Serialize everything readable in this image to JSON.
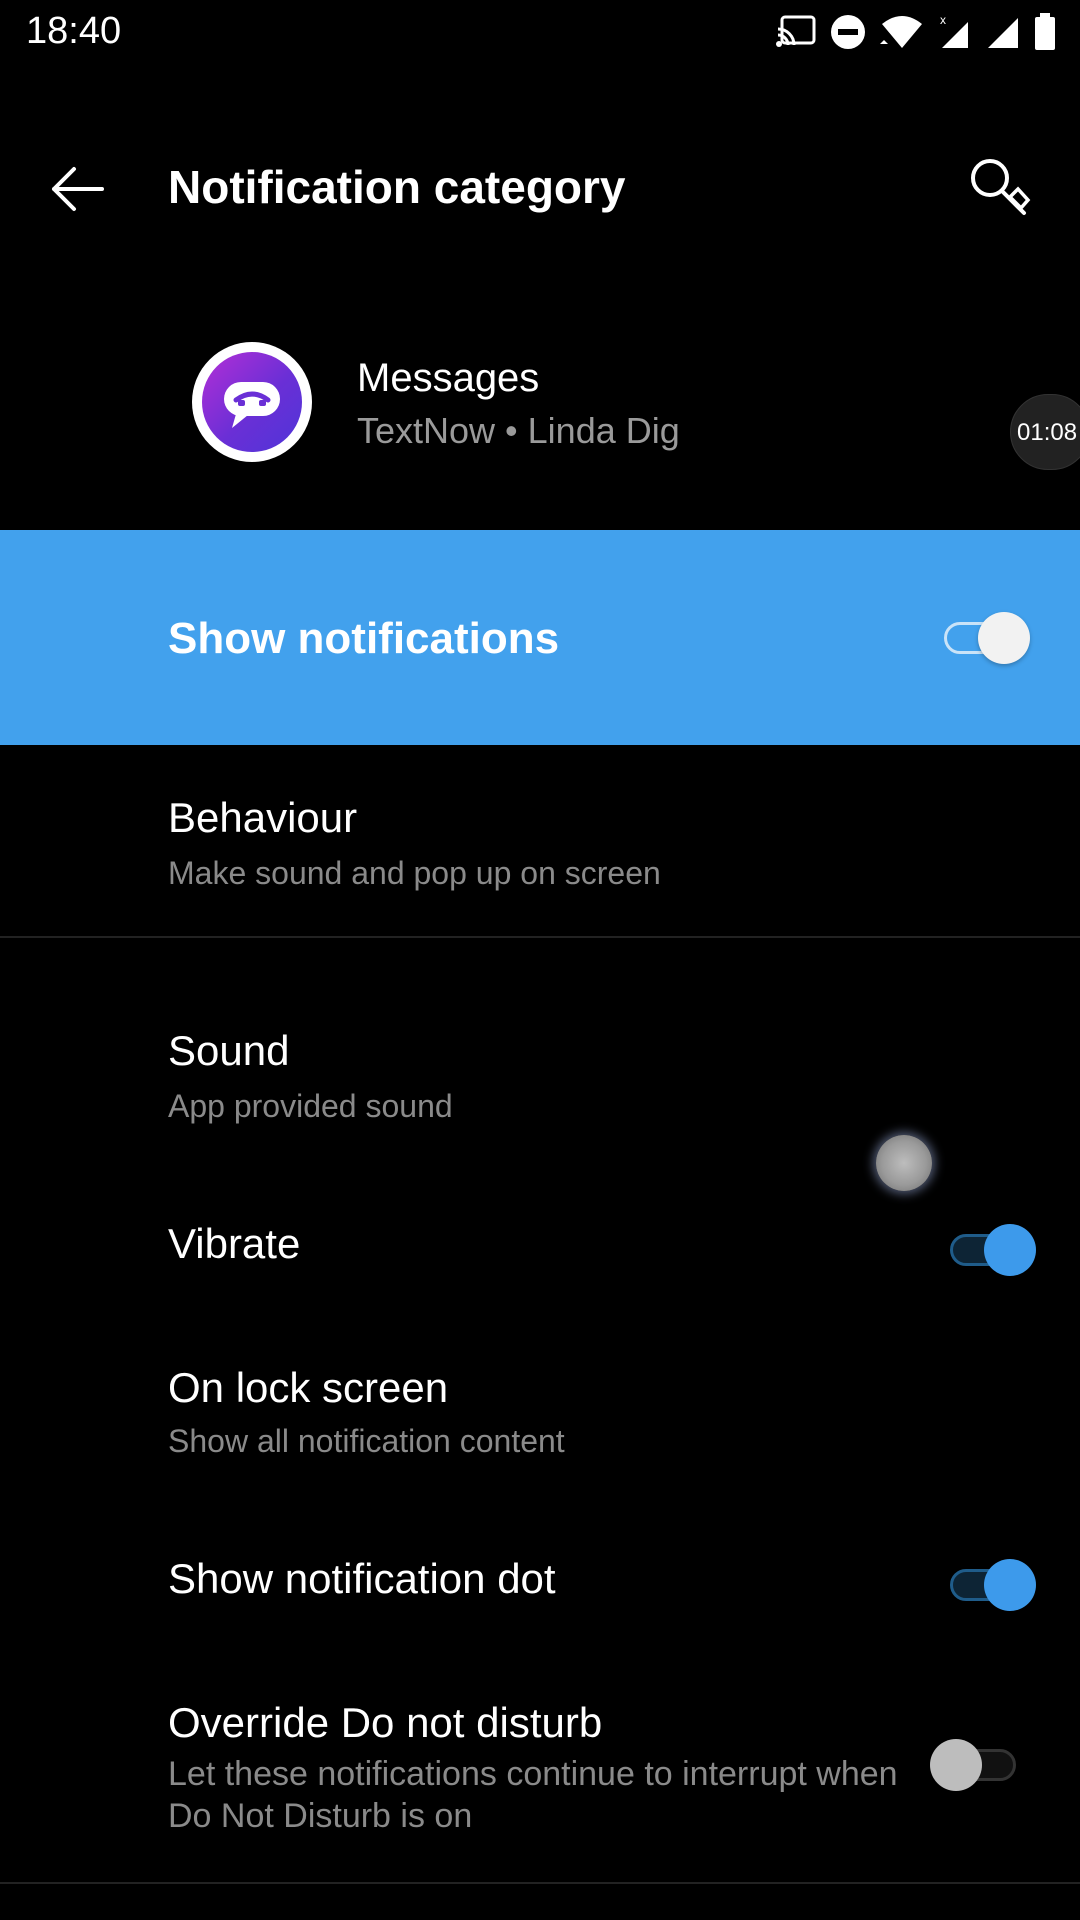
{
  "status_bar": {
    "time": "18:40",
    "icons": [
      "cast-icon",
      "do-not-disturb-icon",
      "wifi-icon",
      "signal-x-icon",
      "signal-icon",
      "battery-icon"
    ]
  },
  "app_bar": {
    "title": "Notification category",
    "back_icon": "arrow-left-icon",
    "search_icon": "search-icon"
  },
  "app_header": {
    "name": "Messages",
    "subtitle": "TextNow • Linda Dig",
    "icon": "textnow-app-icon"
  },
  "timer_bubble": {
    "text": "01:08"
  },
  "show_notifications": {
    "label": "Show notifications",
    "enabled": true
  },
  "settings": {
    "behaviour": {
      "title": "Behaviour",
      "subtitle": "Make sound and pop up on screen"
    },
    "sound": {
      "title": "Sound",
      "subtitle": "App provided sound"
    },
    "vibrate": {
      "title": "Vibrate",
      "enabled": true
    },
    "lock_screen": {
      "title": "On lock screen",
      "subtitle": "Show all notification content"
    },
    "notification_dot": {
      "title": "Show notification dot",
      "enabled": true
    },
    "override_dnd": {
      "title": "Override Do not disturb",
      "subtitle": "Let these notifications continue to interrupt when Do Not Disturb is on",
      "enabled": false
    }
  },
  "colors": {
    "accent": "#42a1ed",
    "toggle_on": "#3d9aeb",
    "background": "#000000",
    "secondary_text": "#8a8a8a"
  }
}
